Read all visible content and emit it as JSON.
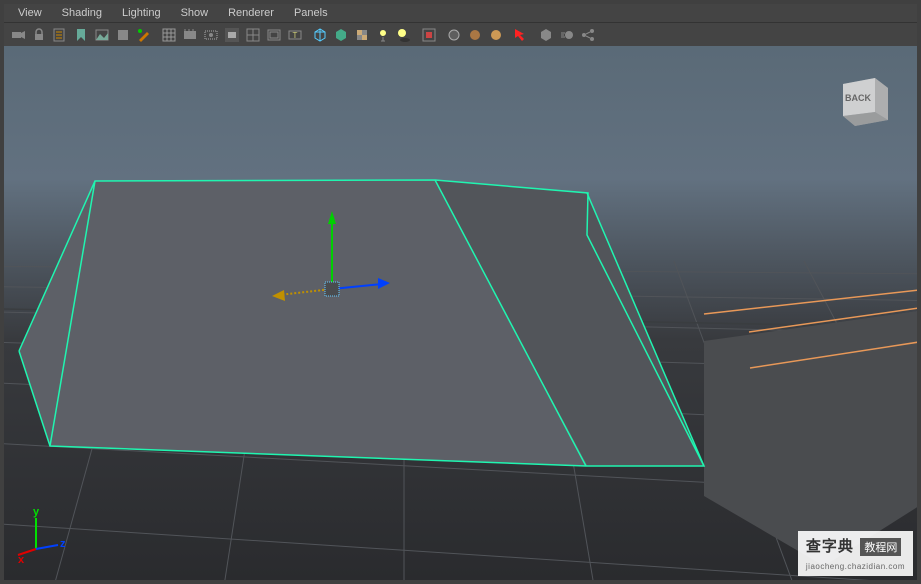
{
  "menu": {
    "view": "View",
    "shading": "Shading",
    "lighting": "Lighting",
    "show": "Show",
    "renderer": "Renderer",
    "panels": "Panels"
  },
  "viewcube": {
    "face": "BACK"
  },
  "axis": {
    "x": "x",
    "y": "y",
    "z": "z"
  },
  "watermark": {
    "cn": "查字典",
    "tag": "教程网",
    "en": "jiaocheng.chazidian.com"
  }
}
